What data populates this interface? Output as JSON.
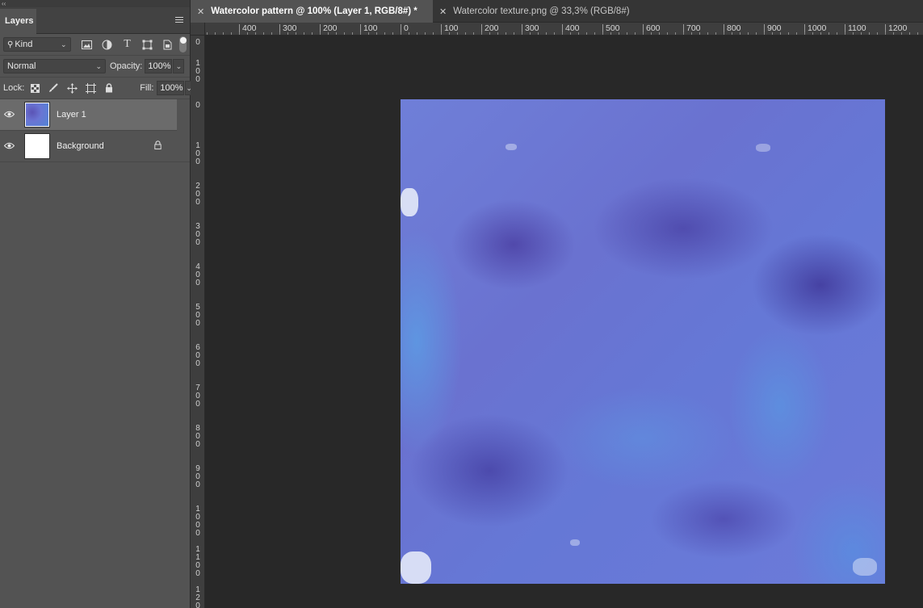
{
  "layers_panel": {
    "collapse_label": "‹‹",
    "tab_label": "Layers",
    "filter_kind": "Kind",
    "filter_icons": [
      "image-filter-icon",
      "adjustment-filter-icon",
      "type-filter-icon",
      "shape-filter-icon",
      "smart-object-filter-icon"
    ],
    "blend_mode": "Normal",
    "opacity_label": "Opacity:",
    "opacity_value": "100%",
    "lock_label": "Lock:",
    "fill_label": "Fill:",
    "fill_value": "100%",
    "layers": [
      {
        "name": "Layer 1",
        "selected": true,
        "visible": true,
        "locked": false
      },
      {
        "name": "Background",
        "selected": false,
        "visible": true,
        "locked": true
      }
    ]
  },
  "tabs": [
    {
      "title": "Watercolor pattern @ 100% (Layer 1, RGB/8#) *",
      "active": true
    },
    {
      "title": "Watercolor texture.png @ 33,3% (RGB/8#)",
      "active": false
    }
  ],
  "h_ruler_labels": [
    "400",
    "300",
    "200",
    "100",
    "0",
    "100",
    "200",
    "300",
    "400",
    "500",
    "600",
    "700",
    "800",
    "900",
    "1000",
    "1100",
    "1200"
  ],
  "v_ruler_labels": [
    "0",
    "100",
    "0",
    "100",
    "200",
    "300",
    "400",
    "500",
    "600",
    "700",
    "800",
    "900",
    "1000",
    "1100",
    "120"
  ],
  "colors": {
    "panel_bg": "#535353",
    "canvas_bg": "#282828",
    "watercolor_blue": "#6a78d6",
    "watercolor_violet": "#4a3fa6"
  }
}
